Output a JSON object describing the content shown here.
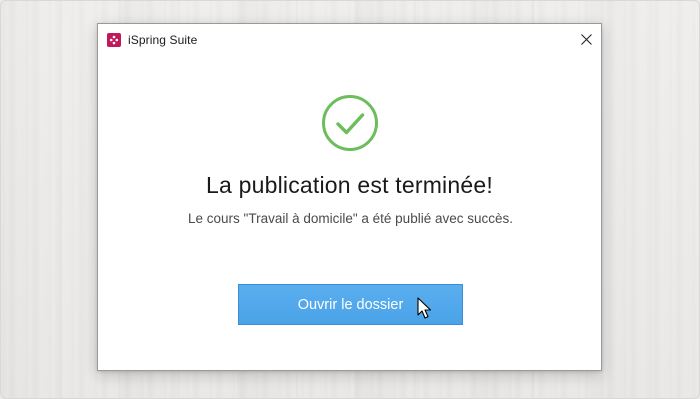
{
  "window": {
    "title": "iSpring Suite",
    "app_icon": "ispring-icon",
    "close_icon": "close-icon"
  },
  "dialog": {
    "status_icon": "checkmark-circle-icon",
    "heading": "La publication est terminée!",
    "message": "Le cours \"Travail à domicile\" a été publié avec succès.",
    "button_label": "Ouvrir le dossier"
  },
  "colors": {
    "success_green": "#6cbd5c",
    "button_blue": "#4aa3e8",
    "brand_magenta": "#c2185b"
  }
}
